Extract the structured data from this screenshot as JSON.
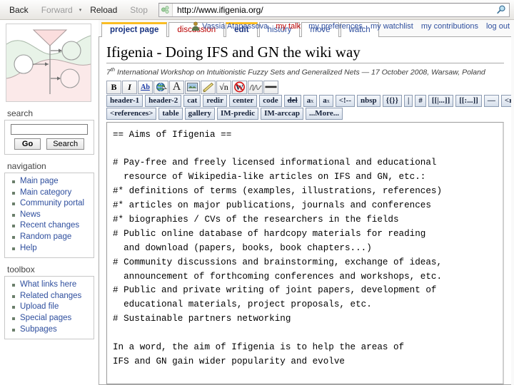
{
  "browser": {
    "back_label": "Back",
    "forward_label": "Forward",
    "dropdown_caret": "▾",
    "reload_label": "Reload",
    "stop_label": "Stop",
    "url": "http://www.ifigenia.org/",
    "favicon_name": "site-favicon",
    "search_icon_name": "magnifier-icon"
  },
  "personal": {
    "user_icon": "user-avatar-icon",
    "username": "Vassia Atanassova",
    "links": [
      {
        "label": "my talk",
        "style": "red"
      },
      {
        "label": "my preferences",
        "style": "blue"
      },
      {
        "label": "my watchlist",
        "style": "blue"
      },
      {
        "label": "my contributions",
        "style": "blue"
      },
      {
        "label": "log out",
        "style": "blue"
      }
    ]
  },
  "sidebar": {
    "logo_alt": "ifigenia-generalized-net-logo",
    "search": {
      "heading": "search",
      "value": "",
      "placeholder": "",
      "go_label": "Go",
      "search_label": "Search"
    },
    "navigation": {
      "heading": "navigation",
      "items": [
        {
          "label": "Main page"
        },
        {
          "label": "Main category"
        },
        {
          "label": "Community portal"
        },
        {
          "label": "News"
        },
        {
          "label": "Recent changes"
        },
        {
          "label": "Random page"
        },
        {
          "label": "Help"
        }
      ]
    },
    "toolbox": {
      "heading": "toolbox",
      "items": [
        {
          "label": "What links here"
        },
        {
          "label": "Related changes"
        },
        {
          "label": "Upload file"
        },
        {
          "label": "Special pages"
        },
        {
          "label": "Subpages"
        }
      ]
    }
  },
  "tabs": [
    {
      "label": "project page",
      "state": "selected"
    },
    {
      "label": "discussion",
      "state": "newpage"
    },
    {
      "label": "edit",
      "state": "selected"
    },
    {
      "label": "history",
      "state": "normal"
    },
    {
      "label": "move",
      "state": "normal"
    },
    {
      "label": "watch",
      "state": "normal"
    }
  ],
  "page": {
    "title": "Ifigenia - Doing IFS and GN the wiki way",
    "subtitle_sup": "th",
    "subtitle_prefix": "7",
    "subtitle_rest": " International Workshop on Intuitionistic Fuzzy Sets and Generalized Nets — 17 October 2008, Warsaw, Poland"
  },
  "toolbar": {
    "icons": [
      {
        "name": "bold-icon",
        "glyph": "B"
      },
      {
        "name": "italic-icon",
        "glyph": "I"
      },
      {
        "name": "internal-link-icon",
        "glyph": "Ab"
      },
      {
        "name": "external-link-icon",
        "glyph": "globe"
      },
      {
        "name": "headline-icon",
        "glyph": "A"
      },
      {
        "name": "embedded-image-icon",
        "glyph": "image"
      },
      {
        "name": "media-file-icon",
        "glyph": "horn"
      },
      {
        "name": "math-formula-icon",
        "glyph": "√n"
      },
      {
        "name": "nowiki-icon",
        "glyph": "W-crossed"
      },
      {
        "name": "signature-icon",
        "glyph": "signature"
      },
      {
        "name": "horizontal-line-icon",
        "glyph": "hr"
      }
    ],
    "row2": [
      {
        "name": "header-1-button",
        "label": "header-1"
      },
      {
        "name": "header-2-button",
        "label": "header-2"
      },
      {
        "name": "cat-button",
        "label": "cat"
      },
      {
        "name": "redir-button",
        "label": "redir"
      },
      {
        "name": "center-button",
        "label": "center"
      },
      {
        "name": "code-button",
        "label": "code"
      },
      {
        "name": "del-button",
        "label": "del"
      },
      {
        "name": "subscript-button",
        "label": "a"
      },
      {
        "name": "superscript-button",
        "label": "a"
      },
      {
        "name": "comment-button",
        "label": "<!--"
      },
      {
        "name": "nbsp-button",
        "label": "nbsp"
      },
      {
        "name": "template-button",
        "label": "{{}}"
      },
      {
        "name": "pipe-button",
        "label": "|"
      },
      {
        "name": "hash-button",
        "label": "#"
      },
      {
        "name": "piped-link-button",
        "label": "[[|...]]"
      },
      {
        "name": "colon-link-button",
        "label": "[[:...]]"
      },
      {
        "name": "mdash-button",
        "label": "—"
      },
      {
        "name": "ref-button",
        "label": "<ref>"
      }
    ],
    "row2_sub_label": "x",
    "row2_sup_label": "x",
    "row3": [
      {
        "name": "references-button",
        "label": "<references>"
      },
      {
        "name": "table-button",
        "label": "table"
      },
      {
        "name": "gallery-button",
        "label": "gallery"
      },
      {
        "name": "im-predic-button",
        "label": "IM-predic"
      },
      {
        "name": "im-arccap-button",
        "label": "IM-arccap"
      },
      {
        "name": "more-button",
        "label": "...More..."
      }
    ]
  },
  "editor": {
    "wikitext": "== Aims of Ifigenia ==\n\n# Pay-free and freely licensed informational and educational\n  resource of Wikipedia-like articles on IFS and GN, etc.:\n#* definitions of terms (examples, illustrations, references)\n#* articles on major publications, journals and conferences\n#* biographies / CVs of the researchers in the fields\n# Public online database of hardcopy materials for reading\n  and download (papers, books, book chapters...)\n# Community discussions and brainstorming, exchange of ideas,\n  announcement of forthcoming conferences and workshops, etc.\n# Public and private writing of joint papers, development of\n  educational materials, project proposals, etc.\n# Sustainable partners networking\n\nIn a word, the aim of Ifigenia is to help the areas of\nIFS and GN gain wider popularity and evolve",
    "placeholder": ""
  },
  "colors": {
    "link_blue": "#2f4f9e",
    "new_link_red": "#ba0000",
    "tab_active_border": "#fabd23",
    "logo_green": "#e4f0e4",
    "logo_pink": "#fae6e6"
  }
}
